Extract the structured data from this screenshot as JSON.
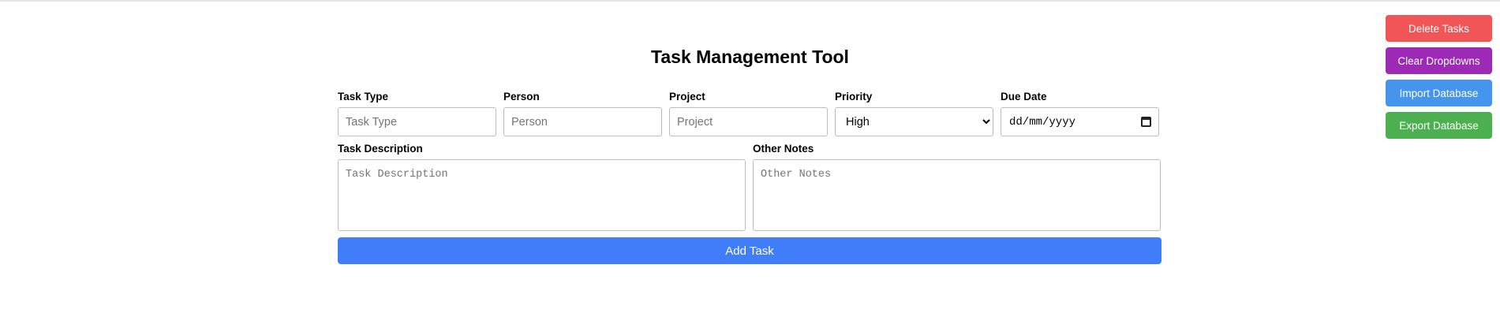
{
  "title": "Task Management Tool",
  "actions": {
    "delete_label": "Delete Tasks",
    "clear_label": "Clear Dropdowns",
    "import_label": "Import Database",
    "export_label": "Export Database"
  },
  "colors": {
    "delete": "#f25555",
    "clear": "#9c2ab5",
    "import": "#4595ee",
    "export": "#4caf50",
    "add": "#3f7ef8"
  },
  "form": {
    "task_type": {
      "label": "Task Type",
      "placeholder": "Task Type",
      "value": ""
    },
    "person": {
      "label": "Person",
      "placeholder": "Person",
      "value": ""
    },
    "project": {
      "label": "Project",
      "placeholder": "Project",
      "value": ""
    },
    "priority": {
      "label": "Priority",
      "value": "High"
    },
    "due_date": {
      "label": "Due Date",
      "placeholder": "dd/mm/yyyy"
    },
    "task_description": {
      "label": "Task Description",
      "placeholder": "Task Description"
    },
    "other_notes": {
      "label": "Other Notes",
      "placeholder": "Other Notes"
    },
    "add_label": "Add Task"
  }
}
